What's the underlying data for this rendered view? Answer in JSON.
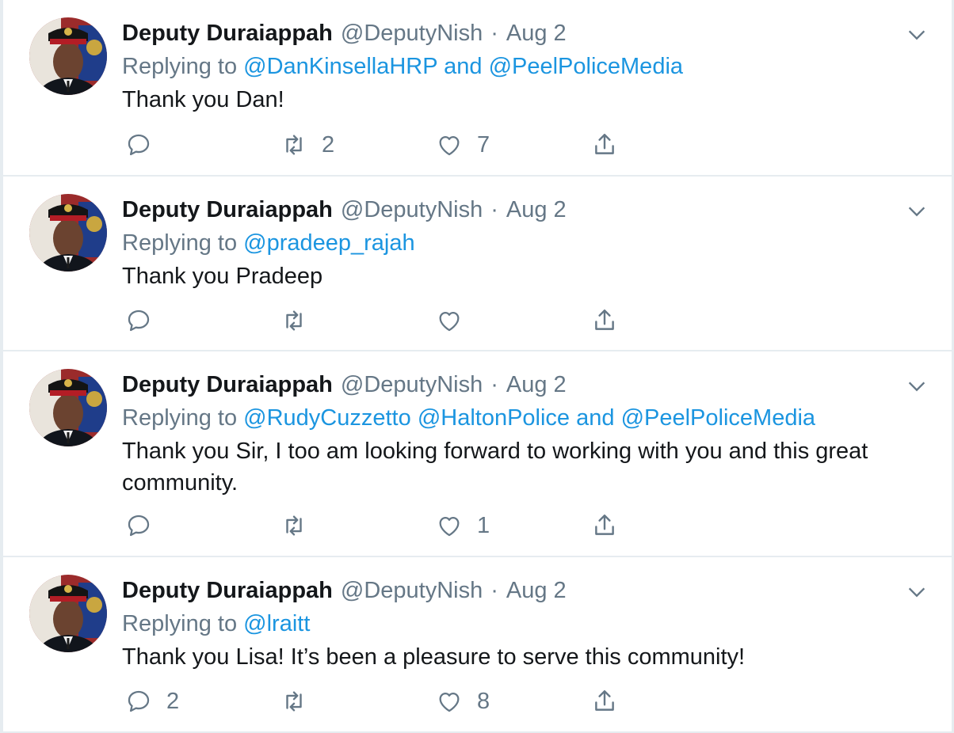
{
  "tweets": [
    {
      "author_name": "Deputy Duraiappah",
      "handle": "@DeputyNish",
      "separator": "·",
      "date": "Aug 2",
      "replying_prefix": "Replying to ",
      "mentions": [
        "@DanKinsellaHRP"
      ],
      "mention_join": " and ",
      "mentions_2": [
        "@PeelPoliceMedia"
      ],
      "text": "Thank you Dan!",
      "reply_count": "",
      "retweet_count": "2",
      "like_count": "7"
    },
    {
      "author_name": "Deputy Duraiappah",
      "handle": "@DeputyNish",
      "separator": "·",
      "date": "Aug 2",
      "replying_prefix": "Replying to ",
      "mentions": [
        "@pradeep_rajah"
      ],
      "mention_join": "",
      "mentions_2": [],
      "text": "Thank you Pradeep",
      "reply_count": "",
      "retweet_count": "",
      "like_count": ""
    },
    {
      "author_name": "Deputy Duraiappah",
      "handle": "@DeputyNish",
      "separator": "·",
      "date": "Aug 2",
      "replying_prefix": "Replying to ",
      "mentions": [
        "@RudyCuzzetto",
        "@HaltonPolice"
      ],
      "mention_join": " and ",
      "mentions_2": [
        "@PeelPoliceMedia"
      ],
      "text": "Thank you Sir, I too am looking forward to working with you and this great community.",
      "reply_count": "",
      "retweet_count": "",
      "like_count": "1"
    },
    {
      "author_name": "Deputy Duraiappah",
      "handle": "@DeputyNish",
      "separator": "·",
      "date": "Aug 2",
      "replying_prefix": "Replying to ",
      "mentions": [
        "@lraitt"
      ],
      "mention_join": "",
      "mentions_2": [],
      "text": "Thank you Lisa! It’s been a pleasure to serve this community!",
      "reply_count": "2",
      "retweet_count": "",
      "like_count": "8"
    }
  ],
  "icons": {
    "reply": "reply-icon",
    "retweet": "retweet-icon",
    "like": "heart-icon",
    "share": "share-icon",
    "menu": "chevron-down-icon"
  },
  "colors": {
    "mention": "#1b95e0",
    "secondary_text": "#657786",
    "primary_text": "#14171a",
    "divider": "#e6ecf0"
  }
}
